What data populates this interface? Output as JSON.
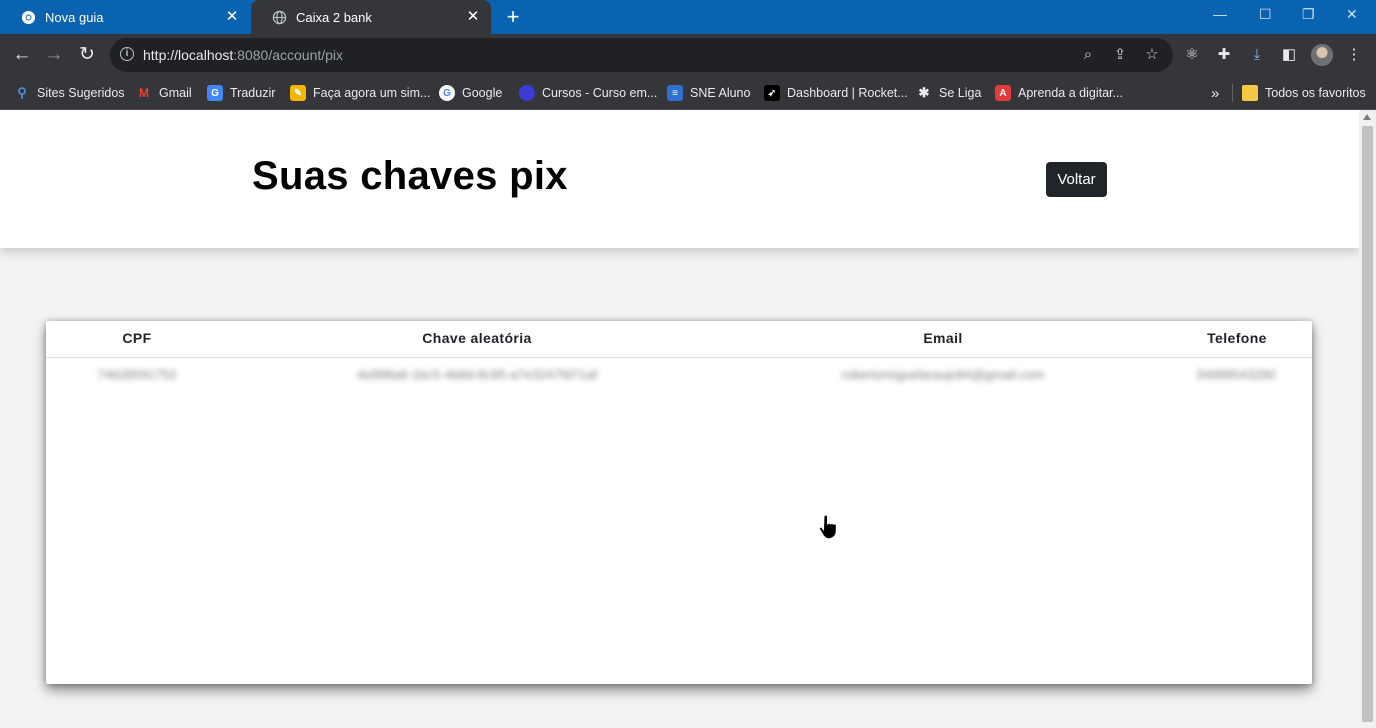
{
  "browser": {
    "tabs": [
      {
        "title": "Nova guia",
        "active": false
      },
      {
        "title": "Caixa 2 bank",
        "active": true
      }
    ],
    "url_host": "http://localhost",
    "url_rest": ":8080/account/pix",
    "bookmarks": [
      {
        "label": "Sites Sugeridos",
        "icon": "magnifier-icon",
        "color": "#4a90d9"
      },
      {
        "label": "Gmail",
        "icon": "gmail-icon",
        "color": "#ea4335"
      },
      {
        "label": "Traduzir",
        "icon": "translate-icon",
        "color": "#4285f4"
      },
      {
        "label": "Faça agora um sim...",
        "icon": "form-icon",
        "color": "#f4b400"
      },
      {
        "label": "Google",
        "icon": "google-icon",
        "color": "#ffffff"
      },
      {
        "label": "Cursos - Curso em...",
        "icon": "cursos-icon",
        "color": "#3b3bd6"
      },
      {
        "label": "SNE Aluno",
        "icon": "sne-icon",
        "color": "#2f6fd0"
      },
      {
        "label": "Dashboard | Rocket...",
        "icon": "rocket-icon",
        "color": "#111111"
      },
      {
        "label": "Se Liga",
        "icon": "paw-icon",
        "color": "#222222"
      },
      {
        "label": "Aprenda a digitar...",
        "icon": "typing-icon",
        "color": "#e23b3b"
      }
    ],
    "more_bookmarks": "»",
    "favorites_folder": "Todos os favoritos"
  },
  "page": {
    "title": "Suas chaves pix",
    "back_button": "Voltar"
  },
  "table": {
    "headers": [
      "CPF",
      "Chave aleatória",
      "Email",
      "Telefone"
    ],
    "rows": [
      [
        "74628591752",
        "4e998a6-1bc5-4b8d-8c95-a7e3247fd71af",
        "robertomiguelaraujo94@gmail.com",
        "34999543290"
      ]
    ]
  },
  "colors": {
    "tabbar": "#0a63b0",
    "chrome": "#35363a",
    "button_bg": "#212529"
  }
}
